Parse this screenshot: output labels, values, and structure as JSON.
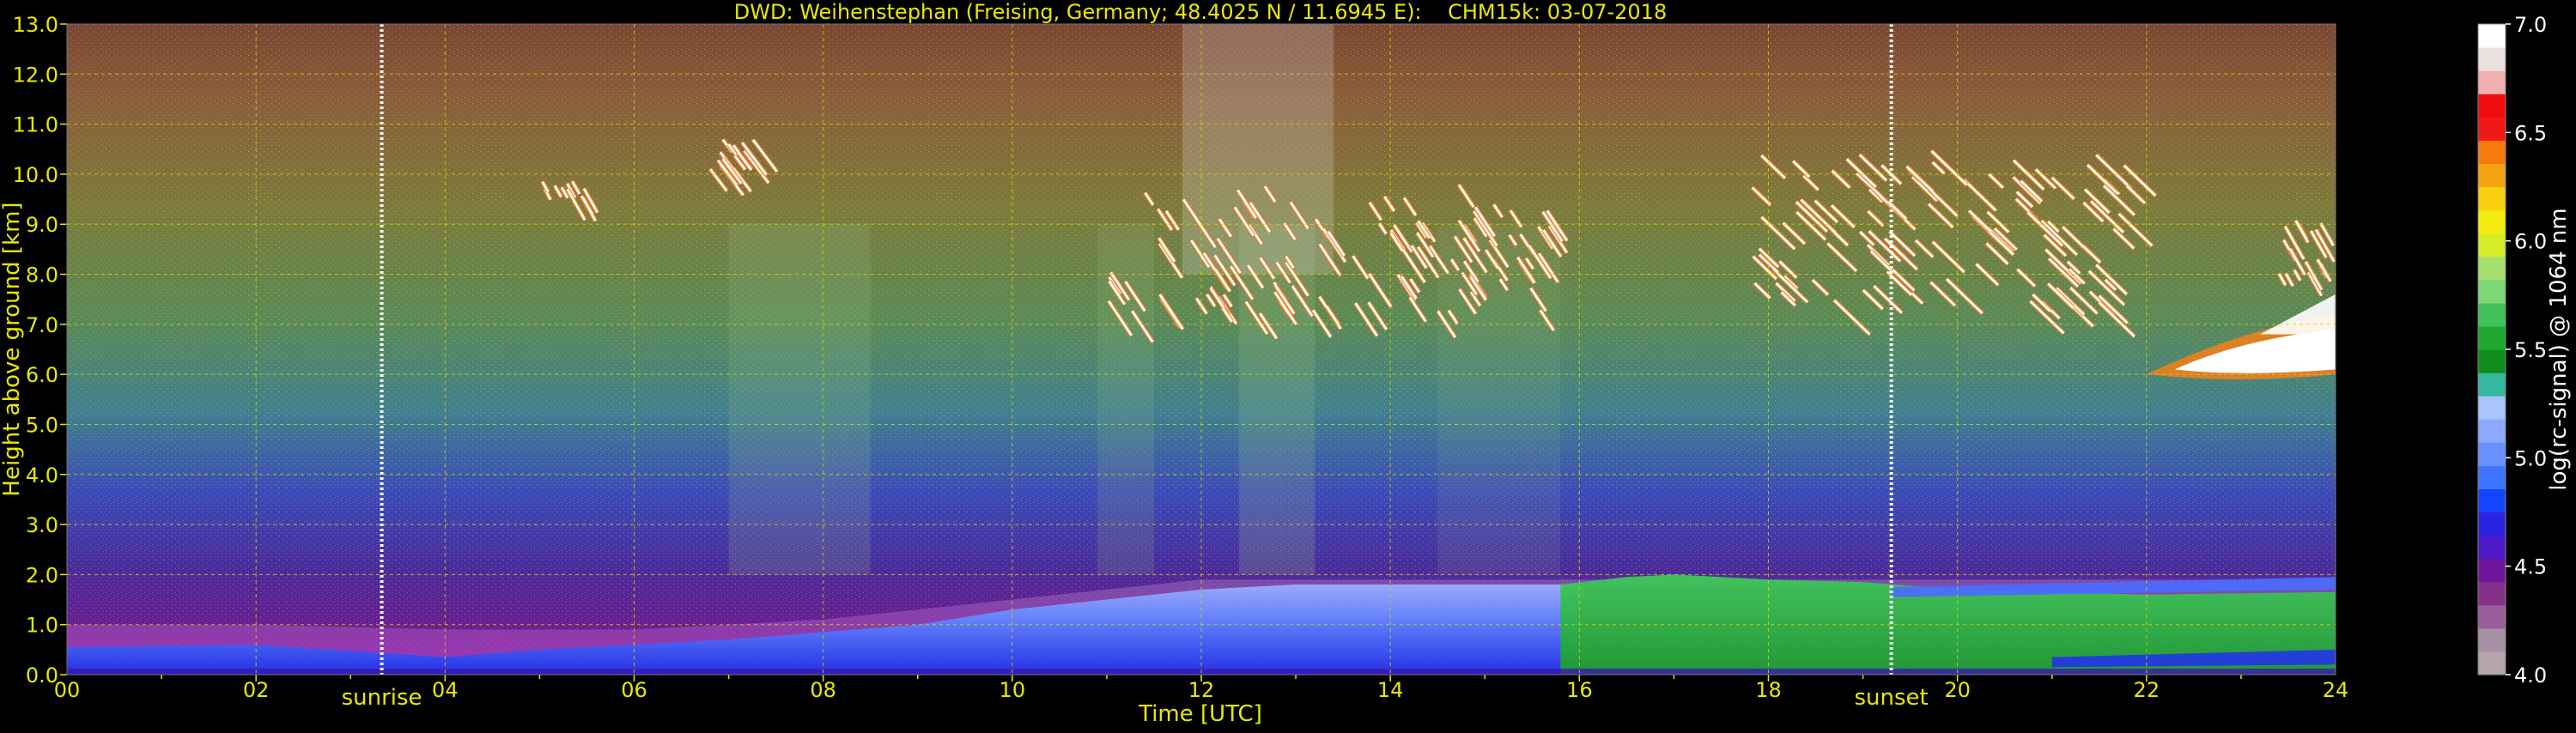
{
  "chart_data": {
    "type": "heatmap",
    "title": "DWD: Weihenstephan (Freising, Germany; 48.4025 N / 11.6945 E):    CHM15k: 03-07-2018",
    "xlabel": "Time [UTC]",
    "ylabel": "Height above ground [km]",
    "xlim": [
      0,
      24
    ],
    "ylim": [
      0,
      13
    ],
    "x_ticks": [
      "00",
      "02",
      "04",
      "06",
      "08",
      "10",
      "12",
      "14",
      "16",
      "18",
      "20",
      "22",
      "24"
    ],
    "y_ticks": [
      "0.0",
      "1.0",
      "2.0",
      "3.0",
      "4.0",
      "5.0",
      "6.0",
      "7.0",
      "8.0",
      "9.0",
      "10.0",
      "11.0",
      "12.0",
      "13.0"
    ],
    "grid": true,
    "markers": [
      {
        "label": "sunrise",
        "time": 3.33
      },
      {
        "label": "sunset",
        "time": 19.3
      }
    ],
    "colorbar": {
      "label": "log(rc-signal) @ 1064 nm",
      "range": [
        4.0,
        7.0
      ],
      "ticks": [
        "4.0",
        "4.5",
        "5.0",
        "5.5",
        "6.0",
        "6.5",
        "7.0"
      ],
      "colors": [
        "#b4a4ac",
        "#a890a4",
        "#985c98",
        "#86308a",
        "#70169c",
        "#4c18c8",
        "#2a24e0",
        "#1444ff",
        "#3c74ff",
        "#6a90ff",
        "#8ca8ff",
        "#aac4ff",
        "#36b8a0",
        "#108c1c",
        "#1ea830",
        "#40c058",
        "#7ed878",
        "#a6e070",
        "#d6ec28",
        "#f4ec10",
        "#f8d010",
        "#f4a410",
        "#f87a0c",
        "#f01818",
        "#ee0c0c",
        "#f0b0b0",
        "#ece0e0",
        "#ffffff"
      ]
    },
    "features": [
      {
        "name": "boundary-layer aerosol",
        "x": [
          0,
          24
        ],
        "top_km": [
          1.0,
          2.0
        ],
        "level": 5.2
      },
      {
        "name": "cirrus",
        "x": [
          11,
          15.7
        ],
        "y_km": [
          6.8,
          10.0
        ],
        "level": 6.8
      },
      {
        "name": "cirrus",
        "x": [
          17.7,
          21.9
        ],
        "y_km": [
          7.2,
          10.7
        ],
        "level": 6.5
      },
      {
        "name": "altocumulus",
        "x": [
          22.0,
          24
        ],
        "y_km": [
          5.6,
          7.5
        ],
        "level": 6.8
      },
      {
        "name": "cirrus",
        "x": [
          6.8,
          7.4
        ],
        "y_km": [
          10.1,
          10.8
        ],
        "level": 6.4
      },
      {
        "name": "cirrus",
        "x": [
          5.0,
          5.6
        ],
        "y_km": [
          9.5,
          9.9
        ],
        "level": 6.2
      }
    ]
  }
}
